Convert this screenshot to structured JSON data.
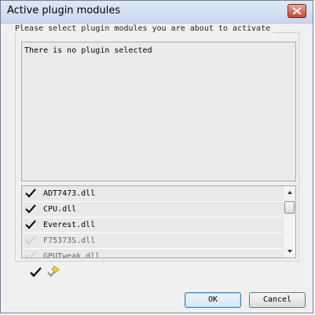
{
  "window": {
    "title": "Active plugin modules"
  },
  "group": {
    "label": "Please select plugin modules you are about to activate"
  },
  "description": {
    "text": "There is no plugin selected"
  },
  "plugins": [
    {
      "name": "ADT7473.dll",
      "checked": true
    },
    {
      "name": "CPU.dll",
      "checked": true
    },
    {
      "name": "Everest.dll",
      "checked": true
    },
    {
      "name": "F75373S.dll",
      "checked": false
    },
    {
      "name": "GPUTweak.dll",
      "checked": false
    }
  ],
  "toolbar": {
    "check_all_icon": "check-all-icon",
    "uncheck_all_icon": "uncheck-all-icon"
  },
  "buttons": {
    "ok": "OK",
    "cancel": "Cancel"
  }
}
